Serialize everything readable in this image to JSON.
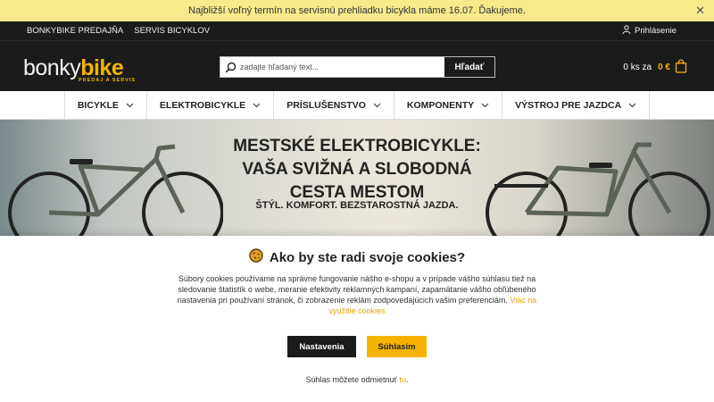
{
  "notice": {
    "text": "Najbližší voľný termín na servisnú prehliadku bicykla máme 16.07. Ďakujeme.",
    "close": "✕"
  },
  "topbar": {
    "links": [
      "BONKYBIKE PREDAJŇA",
      "SERVIS BICYKLOV"
    ],
    "login": "Prihlásenie"
  },
  "header": {
    "logo_white": "bonky",
    "logo_yellow": "bike",
    "logo_sub": "PREDAJ A SERVIS"
  },
  "search": {
    "placeholder": "zadajte hľadaný text...",
    "button": "Hľadať"
  },
  "cart": {
    "count": "0 ks za",
    "price": "0 €"
  },
  "nav": {
    "items": [
      "BICYKLE",
      "ELEKTROBICYKLE",
      "PRÍSLUŠENSTVO",
      "KOMPONENTY",
      "VÝSTROJ PRE JAZDCA"
    ]
  },
  "hero": {
    "line1": "MESTSKÉ ELEKTROBICYKLE:",
    "line2": "VAŠA SVIŽNÁ A SLOBODNÁ",
    "line3": "CESTA MESTOM",
    "sub": "ŠTÝL. KOMFORT. BEZSTAROSTNÁ JAZDA."
  },
  "cookie": {
    "title": "Ako by ste radi svoje cookies?",
    "text": "Súbory cookies používame na správne fungovanie nášho e-shopu a v prípade vášho súhlasu tiež na sledovanie štatistík o webe, meranie efektivity reklamných kampaní, zapamätanie vášho obľúbeného nastavenia pri používaní stránok, či zobrazenie reklám zodpovedajúcich vašim preferenciám.",
    "more_link": "Viac na využitie cookies",
    "settings_button": "Nastavenia",
    "agree_button": "Súhlasím",
    "decline_prefix": "Súhlas môžete odmietnuť",
    "decline_link": "tu",
    "decline_suffix": "."
  },
  "colors": {
    "accent": "#f5b300",
    "dark": "#1b1b1b",
    "notice_bg": "#f7e98c"
  },
  "icons": [
    "close-icon",
    "user-icon",
    "search-icon",
    "cart-bag-icon",
    "chevron-down-icon",
    "cookie-icon"
  ]
}
